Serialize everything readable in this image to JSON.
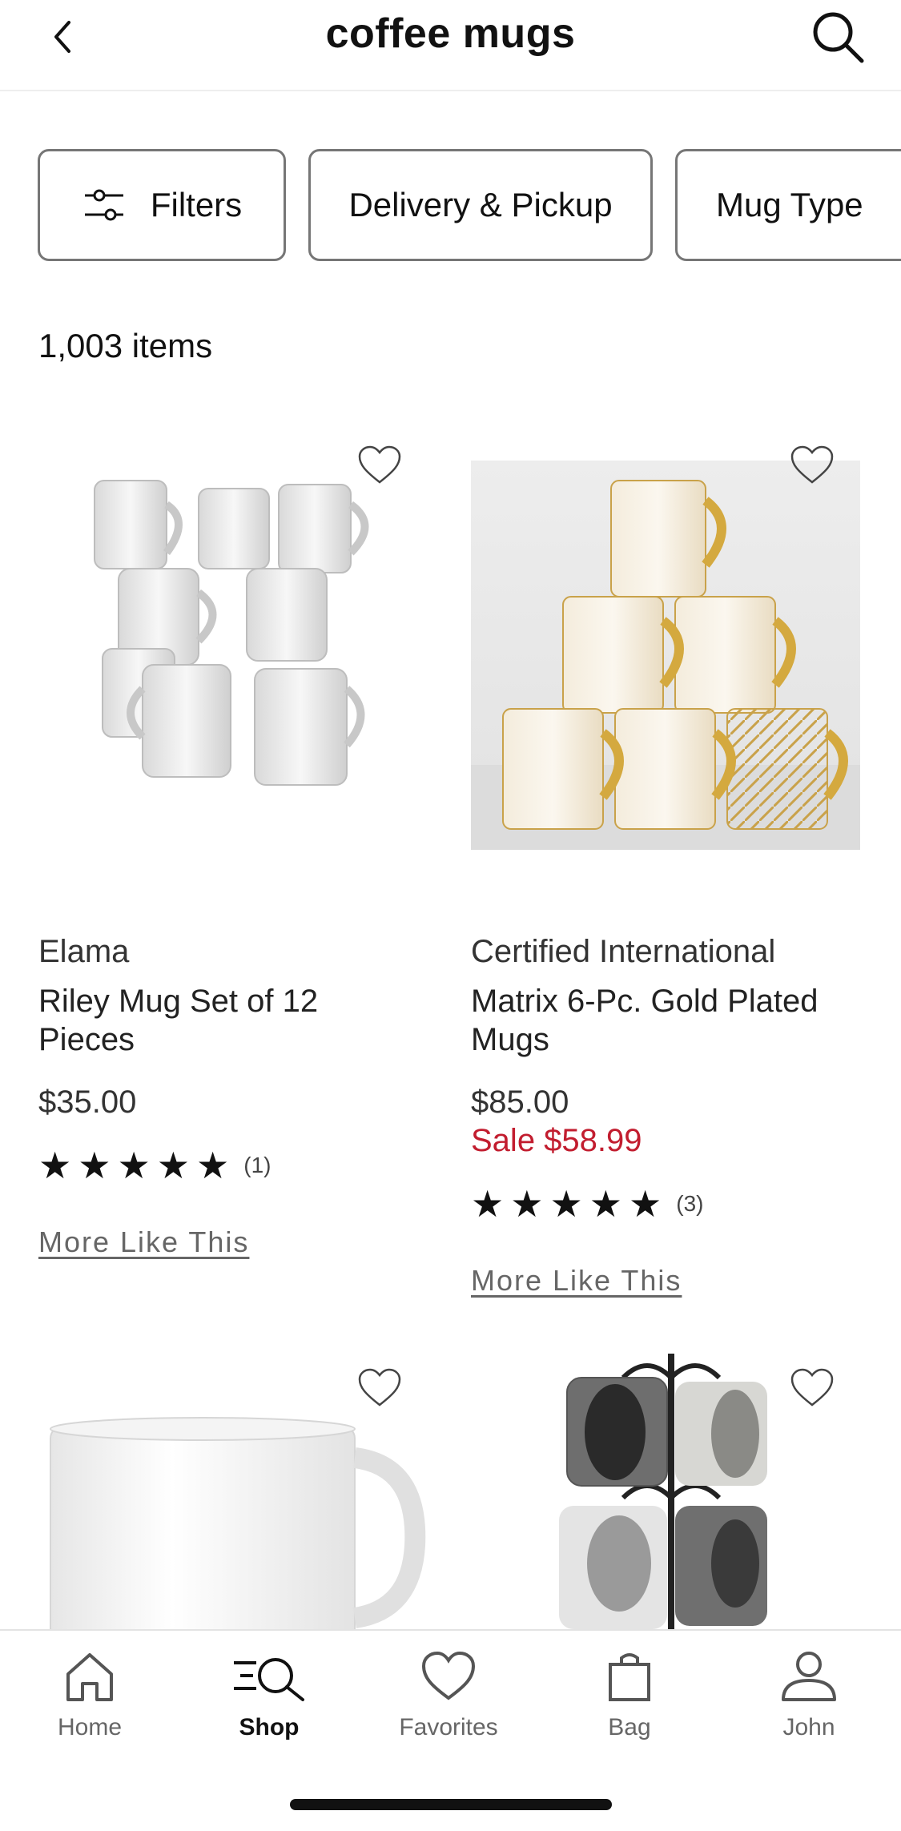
{
  "header": {
    "title": "coffee mugs",
    "back_icon": "chevron-left-icon",
    "search_icon": "search-icon"
  },
  "chips": [
    {
      "label": "Filters",
      "icon": "sliders-icon"
    },
    {
      "label": "Delivery & Pickup"
    },
    {
      "label": "Mug Type"
    }
  ],
  "results": {
    "count": "1,003 items"
  },
  "products": [
    {
      "brand": "Elama",
      "name": "Riley Mug Set of 12 Pieces",
      "price": "$35.00",
      "rating": 5,
      "reviews": "(1)",
      "more": "More Like This"
    },
    {
      "brand": "Certified International",
      "name": "Matrix 6-Pc. Gold Plated Mugs",
      "price": "$85.00",
      "sale": "Sale $58.99",
      "rating": 5,
      "reviews": "(3)",
      "more": "More Like This"
    }
  ],
  "tabbar": {
    "items": [
      {
        "label": "Home",
        "icon": "home-icon"
      },
      {
        "label": "Shop",
        "icon": "shop-search-icon",
        "active": true
      },
      {
        "label": "Favorites",
        "icon": "heart-icon"
      },
      {
        "label": "Bag",
        "icon": "bag-icon"
      },
      {
        "label": "John",
        "icon": "person-icon"
      }
    ]
  },
  "colors": {
    "sale_red": "#c21d2f",
    "border_gray": "#767676"
  }
}
